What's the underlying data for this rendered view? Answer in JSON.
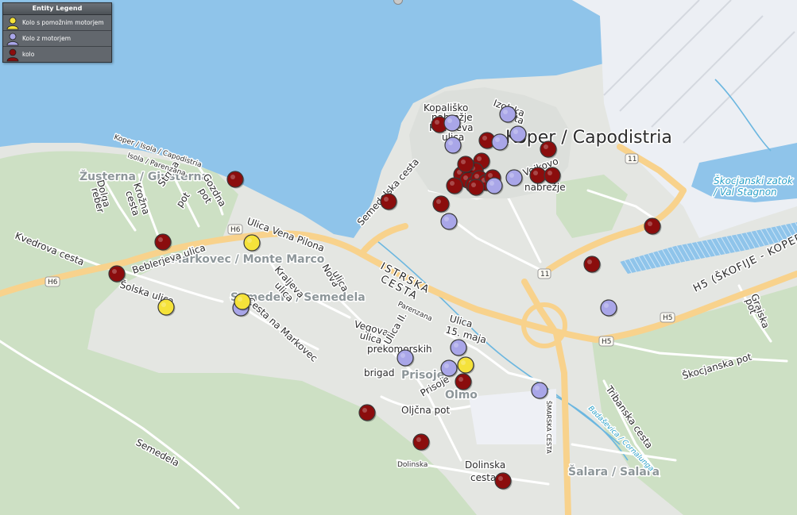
{
  "legend": {
    "title": "Entity Legend",
    "items": [
      {
        "label": "Kolo s pomožnim motorjem",
        "color": "#f5e23a",
        "icon": "person-icon"
      },
      {
        "label": "Kolo z motorjem",
        "color": "#a9a6e8",
        "icon": "person-icon"
      },
      {
        "label": "kolo",
        "color": "#8b0d0d",
        "icon": "person-icon"
      }
    ]
  },
  "colors": {
    "sea": "#8fc4ea",
    "land": "#e4e6e2",
    "green": "#cde0c4",
    "port": "#eceff4",
    "highway": "#f8d28c",
    "road": "#ffffff",
    "water_label": "#2aa0c8"
  },
  "labels": {
    "city": "Koper / Capodistria",
    "zusterna": "Žusterna / Giusterna",
    "markovec": "Markovec / Monte Marco",
    "semedela_place": "Semedela / Semedela",
    "prisoje": "Prisoje",
    "olmo": "Olmo",
    "salara": "Šalara / Salara",
    "skocjanski": "Škocjanski zatok",
    "val_stagnon": "/ Val Stagnon",
    "kopalisko1": "Kopališko",
    "kopalisko2": "nabrežje",
    "kidriceva1": "Kidričeva",
    "kidriceva2": "ulica",
    "izolska1": "Izolska",
    "izolska2": "vrata",
    "vojkovo1": "Vojkovo",
    "vojkovo2": "nabrežje",
    "semedelska": "Semedelska cesta",
    "istrska1": "ISTRSKA",
    "istrska2": "CESTA",
    "vena_pilona": "Ulica Vena Pilona",
    "kvedrova": "Kvedrova cesta",
    "beblerjeva": "Beblerjeva ulica",
    "solska": "Šolska ulica",
    "cesta_na_markovec": "Cesta na Markovec",
    "kraljeva1": "Kraljeva",
    "kraljeva2": "ulica",
    "nova1": "Nova",
    "nova2": "ulica",
    "vegova1": "Vegova",
    "vegova2": "ulica",
    "ulica15_1": "Ulica",
    "ulica15_2": "15. maja",
    "prekomorskih1": "Ulica II.",
    "prekomorskih2": "prekomorskih",
    "prekomorskih3": "brigad",
    "prisoje_st": "Prisoje",
    "oljcna": "Oljčna pot",
    "dolinska1": "Dolinska",
    "dolinska2": "cesta",
    "dolinska_small": "Dolinska",
    "semedela_road": "Semedela",
    "tribanska": "Tribanska cesta",
    "skocjanska": "Škocjanska pot",
    "grajska1": "Grajska",
    "grajska2": "pot",
    "h5": "H5 (ŠKOFIJE - KOPER)",
    "smarska": "ŠMARSKA CESTA",
    "badasevica": "Badaševica / Cornalunga",
    "dolga1": "Dolga",
    "dolga2": "reber",
    "krozna1": "Krožna",
    "krozna2": "cesta",
    "strma1": "Strma",
    "strma2": "pot",
    "gozdna1": "Gozdna",
    "gozdna2": "pot",
    "koper_isola": "Koper / Isola / Capodistria",
    "isola_parenzana": "Isola / Parenzana",
    "parenzana": "Parenzana",
    "shield_h6a": "H6",
    "shield_h6b": "H6",
    "shield_11a": "11",
    "shield_11b": "11",
    "shield_h5a": "H5",
    "shield_h5b": "H5"
  },
  "markers": {
    "kolo": 27,
    "kolo_z_motorjem": 14,
    "kolo_s_pomoznim_motorjem": 4
  }
}
